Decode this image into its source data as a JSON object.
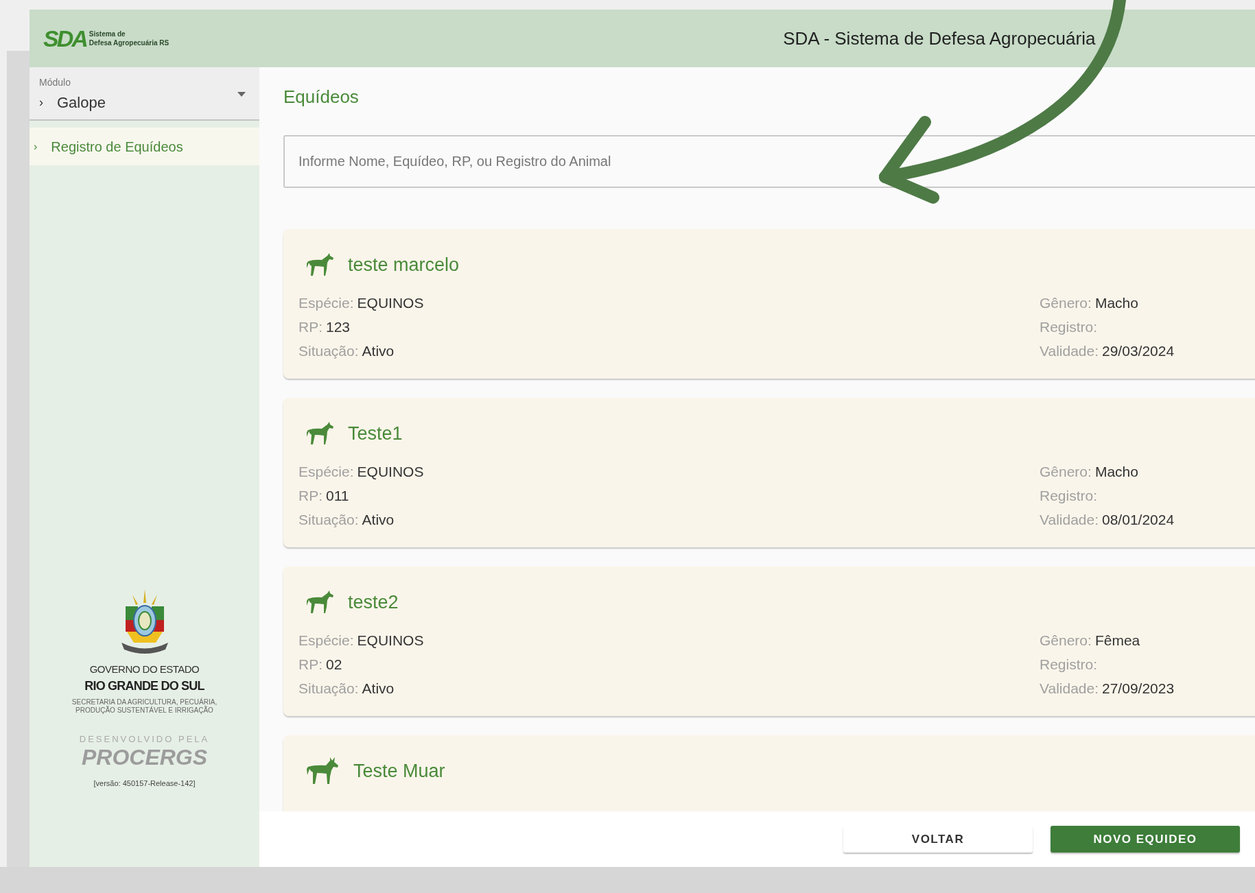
{
  "header": {
    "logo_mark": "SDA",
    "logo_line_1": "Sistema de",
    "logo_line_2": "Defesa Agropecuária RS",
    "title": "SDA - Sistema de Defesa Agropecuária"
  },
  "sidebar": {
    "module_label": "Módulo",
    "module_chevron": "›",
    "module_value": "Galope",
    "items": [
      {
        "chevron": "›",
        "label": "Registro de Equídeos",
        "selected": true
      }
    ],
    "footer": {
      "gov_line_1": "GOVERNO DO ESTADO",
      "gov_line_2": "RIO GRANDE DO SUL",
      "secretaria_1": "SECRETARIA DA AGRICULTURA, PECUÁRIA,",
      "secretaria_2": "PRODUÇÃO SUSTENTÁVEL E IRRIGAÇÃO",
      "developed_by": "DESENVOLVIDO PELA",
      "developer": "PROCERGS",
      "version": "[versão: 450157-Release-142]"
    }
  },
  "main": {
    "title": "Equídeos",
    "search": {
      "placeholder": "Informe Nome, Equídeo, RP, ou Registro do Animal"
    },
    "cards": [
      {
        "kind": "horse",
        "name": "teste marcelo",
        "left": [
          {
            "label": "Espécie:",
            "value": "EQUINOS"
          },
          {
            "label": "RP:",
            "value": "123"
          },
          {
            "label": "Situação:",
            "value": "Ativo"
          }
        ],
        "right": [
          {
            "label": "Gênero:",
            "value": "Macho"
          },
          {
            "label": "Registro:"
          },
          {
            "label": "Validade:",
            "value": "29/03/2024"
          }
        ]
      },
      {
        "kind": "horse",
        "name": "Teste1",
        "left": [
          {
            "label": "Espécie:",
            "value": "EQUINOS"
          },
          {
            "label": "RP:",
            "value": "011"
          },
          {
            "label": "Situação:",
            "value": "Ativo"
          }
        ],
        "right": [
          {
            "label": "Gênero:",
            "value": "Macho"
          },
          {
            "label": "Registro:"
          },
          {
            "label": "Validade:",
            "value": "08/01/2024"
          }
        ]
      },
      {
        "kind": "horse",
        "name": "teste2",
        "left": [
          {
            "label": "Espécie:",
            "value": "EQUINOS"
          },
          {
            "label": "RP:",
            "value": "02"
          },
          {
            "label": "Situação:",
            "value": "Ativo"
          }
        ],
        "right": [
          {
            "label": "Gênero:",
            "value": "Fêmea"
          },
          {
            "label": "Registro:"
          },
          {
            "label": "Validade:",
            "value": "27/09/2023"
          }
        ]
      },
      {
        "kind": "donkey",
        "name": "Teste Muar"
      }
    ],
    "buttons": [
      {
        "kind": "secondary",
        "label": "VOLTAR"
      },
      {
        "kind": "primary",
        "label": "NOVO EQUIDEO"
      }
    ]
  }
}
